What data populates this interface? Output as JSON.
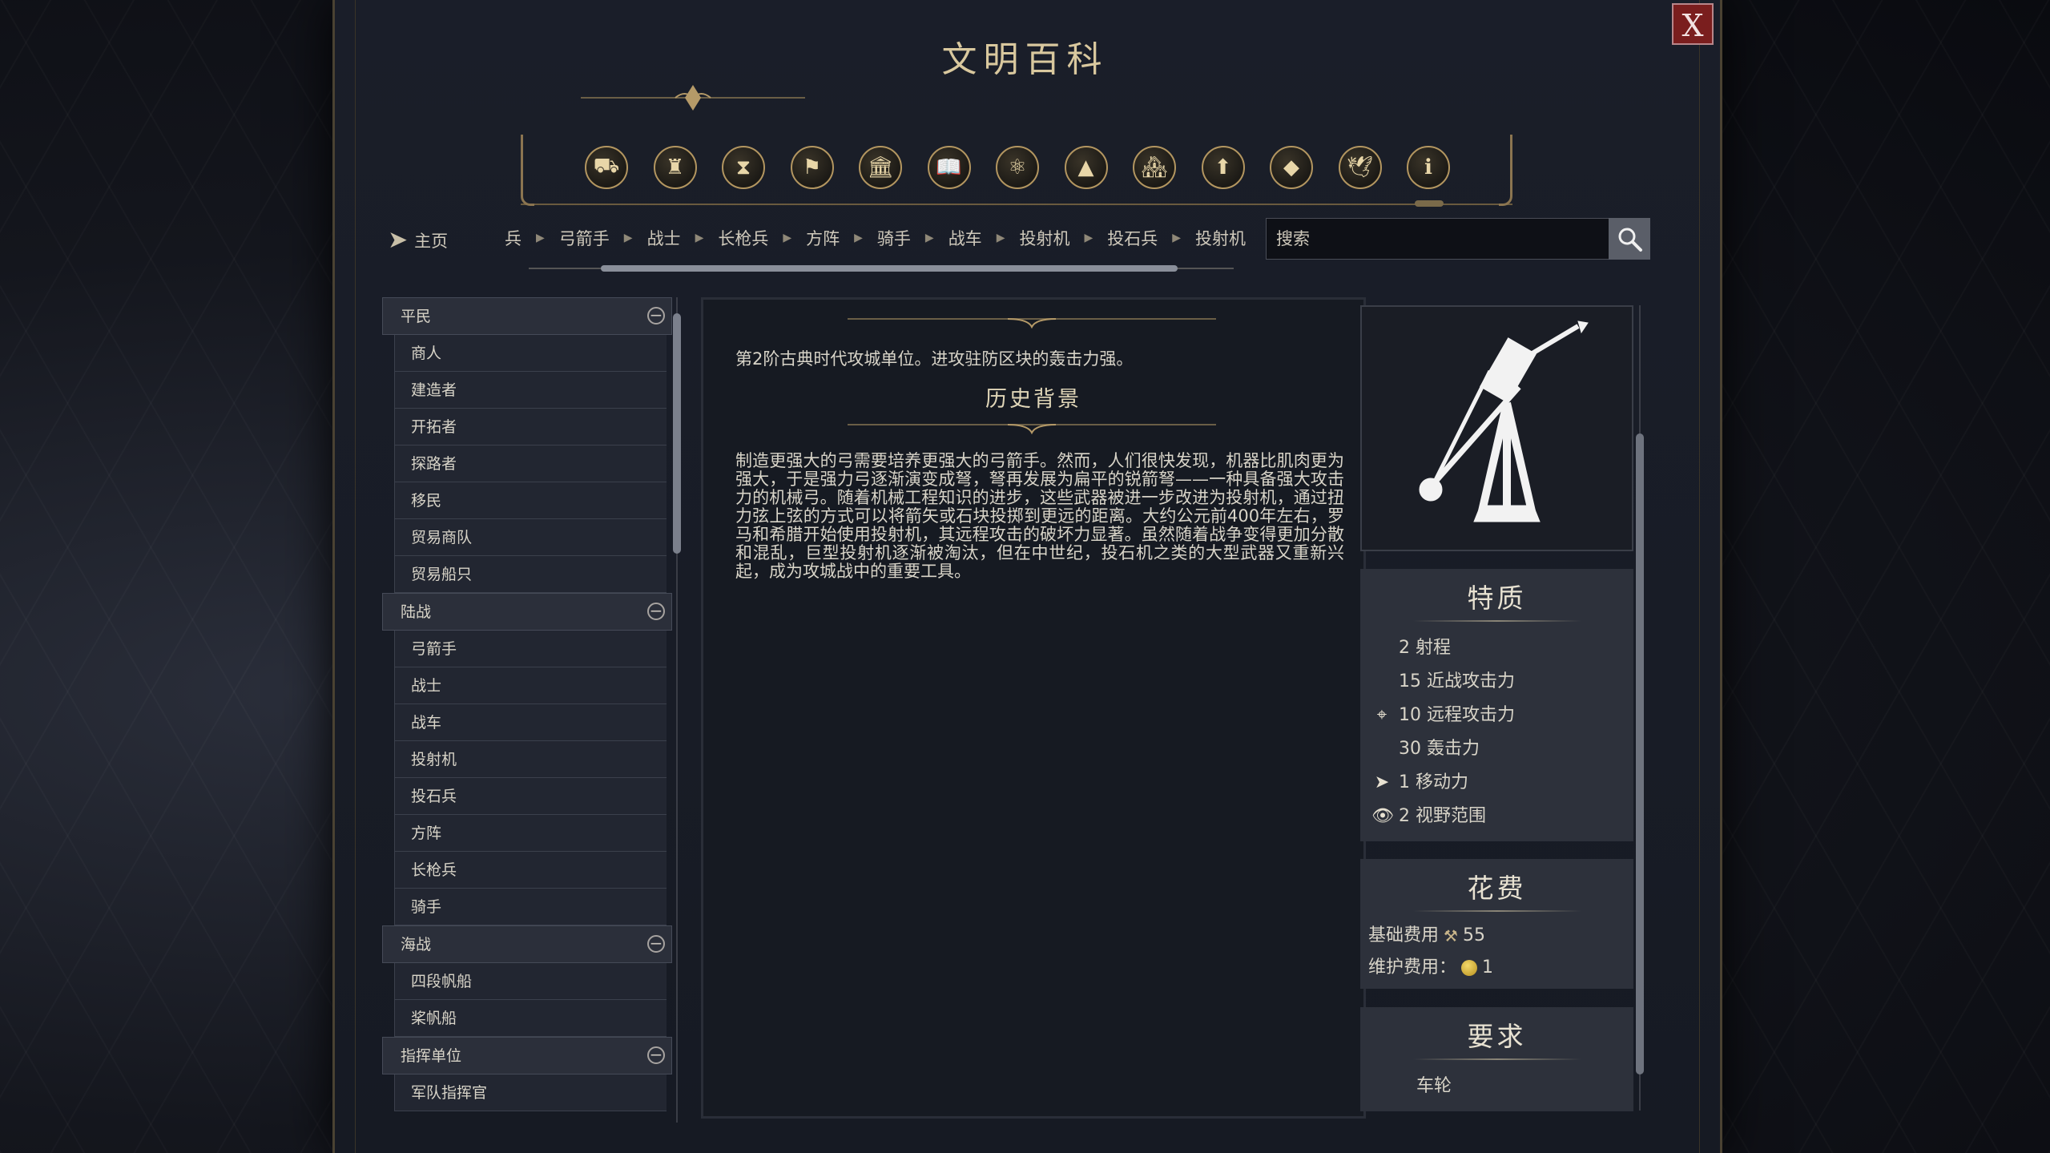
{
  "window": {
    "title": "文明百科",
    "close_label": "X"
  },
  "category_icons": [
    {
      "name": "units-icon",
      "glyph": "⛟"
    },
    {
      "name": "buildings-icon",
      "glyph": "♜"
    },
    {
      "name": "history-icon",
      "glyph": "⧗"
    },
    {
      "name": "civilizations-icon",
      "glyph": "⚑"
    },
    {
      "name": "government-icon",
      "glyph": "🏛"
    },
    {
      "name": "religion-icon",
      "glyph": "📖"
    },
    {
      "name": "technology-icon",
      "glyph": "⚛"
    },
    {
      "name": "terrain-icon",
      "glyph": "▲"
    },
    {
      "name": "districts-icon",
      "glyph": "🏘"
    },
    {
      "name": "improvements-icon",
      "glyph": "⬆"
    },
    {
      "name": "resources-icon",
      "glyph": "◆"
    },
    {
      "name": "great-people-icon",
      "glyph": "🕊"
    },
    {
      "name": "info-icon",
      "glyph": "ℹ"
    }
  ],
  "nav": {
    "home_label": "主页",
    "breadcrumbs": [
      "兵",
      "弓箭手",
      "战士",
      "长枪兵",
      "方阵",
      "骑手",
      "战车",
      "投射机",
      "投石兵",
      "投射机"
    ],
    "search_placeholder": "搜索"
  },
  "sidebar": {
    "groups": [
      {
        "label": "平民",
        "items": [
          "商人",
          "建造者",
          "开拓者",
          "探路者",
          "移民",
          "贸易商队",
          "贸易船只"
        ]
      },
      {
        "label": "陆战",
        "items": [
          "弓箭手",
          "战士",
          "战车",
          "投射机",
          "投石兵",
          "方阵",
          "长枪兵",
          "骑手"
        ]
      },
      {
        "label": "海战",
        "items": [
          "四段帆船",
          "桨帆船"
        ]
      },
      {
        "label": "指挥单位",
        "items": [
          "军队指挥官"
        ]
      }
    ]
  },
  "content": {
    "summary": "第2阶古典时代攻城单位。进攻驻防区块的轰击力强。",
    "history_title": "历史背景",
    "history_text": "制造更强大的弓需要培养更强大的弓箭手。然而，人们很快发现，机器比肌肉更为强大，于是强力弓逐渐演变成弩，弩再发展为扁平的锐箭弩——一种具备强大攻击力的机械弓。随着机械工程知识的进步，这些武器被进一步改进为投射机，通过扭力弦上弦的方式可以将箭矢或石块投掷到更远的距离。大约公元前400年左右，罗马和希腊开始使用投射机，其远程攻击的破坏力显著。虽然随着战争变得更加分散和混乱，巨型投射机逐渐被淘汰，但在中世纪，投石机之类的大型武器又重新兴起，成为攻城战中的重要工具。"
  },
  "traits": {
    "title": "特质",
    "rows": [
      {
        "icon": "",
        "icon_name": "range-icon",
        "value": "2",
        "label": "射程"
      },
      {
        "icon": "",
        "icon_name": "melee-icon",
        "value": "15",
        "label": "近战攻击力"
      },
      {
        "icon": "⌖",
        "icon_name": "ranged-target-icon",
        "value": "10",
        "label": "远程攻击力"
      },
      {
        "icon": "",
        "icon_name": "bombard-icon",
        "value": "30",
        "label": "轰击力"
      },
      {
        "icon": "➤",
        "icon_name": "movement-icon",
        "value": "1",
        "label": "移动力"
      },
      {
        "icon": "👁",
        "icon_name": "eye-icon",
        "value": "2",
        "label": "视野范围"
      }
    ]
  },
  "cost": {
    "title": "花费",
    "base_label": "基础费用",
    "base_value": "55",
    "maint_label": "维护费用：",
    "maint_value": "1"
  },
  "requirements": {
    "title": "要求",
    "items": [
      "车轮"
    ]
  },
  "colors": {
    "accent_gold": "#d9c89e",
    "close_red": "#7a1e1e"
  }
}
